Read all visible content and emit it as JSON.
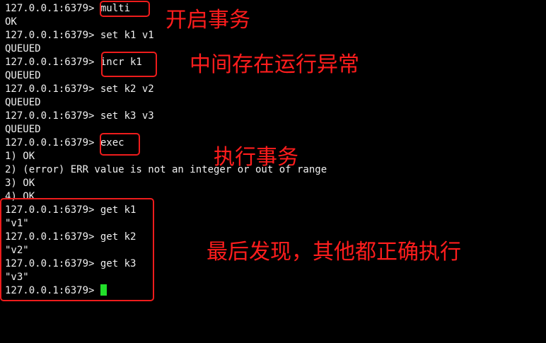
{
  "terminal": {
    "lines": [
      {
        "prompt": "127.0.0.1:6379> ",
        "text": "multi"
      },
      {
        "prompt": "",
        "text": "OK"
      },
      {
        "prompt": "127.0.0.1:6379> ",
        "text": "set k1 v1"
      },
      {
        "prompt": "",
        "text": "QUEUED"
      },
      {
        "prompt": "127.0.0.1:6379> ",
        "text": "incr k1"
      },
      {
        "prompt": "",
        "text": "QUEUED"
      },
      {
        "prompt": "127.0.0.1:6379> ",
        "text": "set k2 v2"
      },
      {
        "prompt": "",
        "text": "QUEUED"
      },
      {
        "prompt": "127.0.0.1:6379> ",
        "text": "set k3 v3"
      },
      {
        "prompt": "",
        "text": "QUEUED"
      },
      {
        "prompt": "127.0.0.1:6379> ",
        "text": "exec"
      },
      {
        "prompt": "",
        "text": "1) OK"
      },
      {
        "prompt": "",
        "text": "2) (error) ERR value is not an integer or out of range"
      },
      {
        "prompt": "",
        "text": "3) OK"
      },
      {
        "prompt": "",
        "text": "4) OK"
      },
      {
        "prompt": "127.0.0.1:6379> ",
        "text": "get k1"
      },
      {
        "prompt": "",
        "text": "\"v1\""
      },
      {
        "prompt": "127.0.0.1:6379> ",
        "text": "get k2"
      },
      {
        "prompt": "",
        "text": "\"v2\""
      },
      {
        "prompt": "127.0.0.1:6379> ",
        "text": "get k3"
      },
      {
        "prompt": "",
        "text": "\"v3\""
      },
      {
        "prompt": "127.0.0.1:6379> ",
        "text": ""
      }
    ]
  },
  "annotations": {
    "open_transaction": "开启事务",
    "runtime_error": "中间存在运行异常",
    "exec_transaction": "执行事务",
    "result": "最后发现，其他都正确执行"
  },
  "colors": {
    "background": "#000000",
    "text": "#f0f0f0",
    "annotation": "#ff1d1d",
    "cursor": "#22e02a"
  }
}
